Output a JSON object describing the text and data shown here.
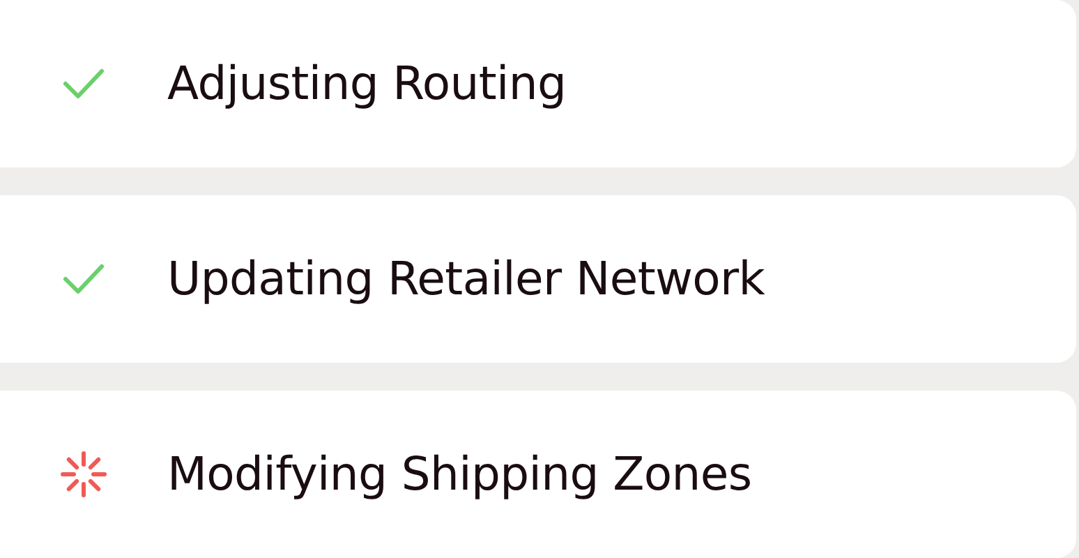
{
  "steps": [
    {
      "label": "Adjusting Routing",
      "kind": "done"
    },
    {
      "label": "Updating Retailer Network",
      "kind": "done"
    },
    {
      "label": "Modifying Shipping Zones",
      "kind": "loading"
    }
  ]
}
